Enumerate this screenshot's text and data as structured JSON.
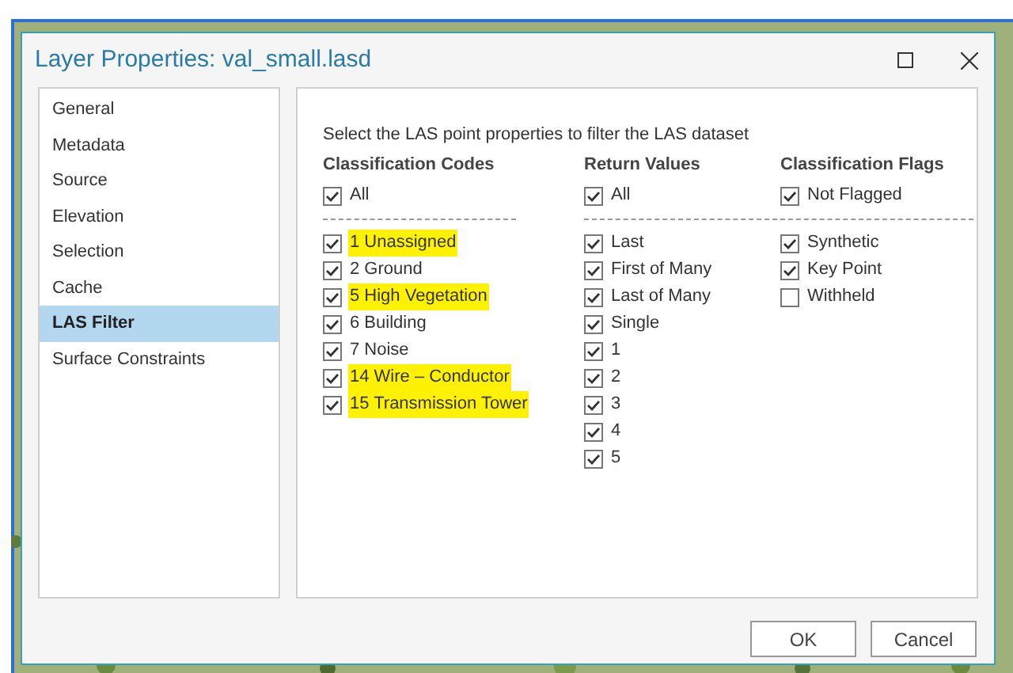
{
  "window": {
    "title": "Layer Properties: val_small.lasd"
  },
  "sidebar": {
    "items": [
      {
        "label": "General",
        "selected": false
      },
      {
        "label": "Metadata",
        "selected": false
      },
      {
        "label": "Source",
        "selected": false
      },
      {
        "label": "Elevation",
        "selected": false
      },
      {
        "label": "Selection",
        "selected": false
      },
      {
        "label": "Cache",
        "selected": false
      },
      {
        "label": "LAS Filter",
        "selected": true
      },
      {
        "label": "Surface Constraints",
        "selected": false
      }
    ]
  },
  "instruction": "Select the LAS point properties to filter the LAS dataset",
  "groups": [
    {
      "title": "Classification Codes",
      "all": {
        "label": "All",
        "checked": true
      },
      "items": [
        {
          "label": "1 Unassigned",
          "checked": true,
          "highlighted": true
        },
        {
          "label": "2 Ground",
          "checked": true,
          "highlighted": false
        },
        {
          "label": "5 High Vegetation",
          "checked": true,
          "highlighted": true
        },
        {
          "label": "6 Building",
          "checked": true,
          "highlighted": false
        },
        {
          "label": "7 Noise",
          "checked": true,
          "highlighted": false
        },
        {
          "label": "14 Wire – Conductor",
          "checked": true,
          "highlighted": true
        },
        {
          "label": "15 Transmission Tower",
          "checked": true,
          "highlighted": true
        }
      ]
    },
    {
      "title": "Return Values",
      "all": {
        "label": "All",
        "checked": true
      },
      "items": [
        {
          "label": "Last",
          "checked": true,
          "highlighted": false
        },
        {
          "label": "First of Many",
          "checked": true,
          "highlighted": false
        },
        {
          "label": "Last of Many",
          "checked": true,
          "highlighted": false
        },
        {
          "label": "Single",
          "checked": true,
          "highlighted": false
        },
        {
          "label": "1",
          "checked": true,
          "highlighted": false
        },
        {
          "label": "2",
          "checked": true,
          "highlighted": false
        },
        {
          "label": "3",
          "checked": true,
          "highlighted": false
        },
        {
          "label": "4",
          "checked": true,
          "highlighted": false
        },
        {
          "label": "5",
          "checked": true,
          "highlighted": false
        }
      ]
    },
    {
      "title": "Classification Flags",
      "all": {
        "label": "Not Flagged",
        "checked": true
      },
      "items": [
        {
          "label": "Synthetic",
          "checked": true,
          "highlighted": false
        },
        {
          "label": "Key Point",
          "checked": true,
          "highlighted": false
        },
        {
          "label": "Withheld",
          "checked": false,
          "highlighted": false
        }
      ]
    }
  ],
  "buttons": [
    "OK",
    "Cancel"
  ]
}
